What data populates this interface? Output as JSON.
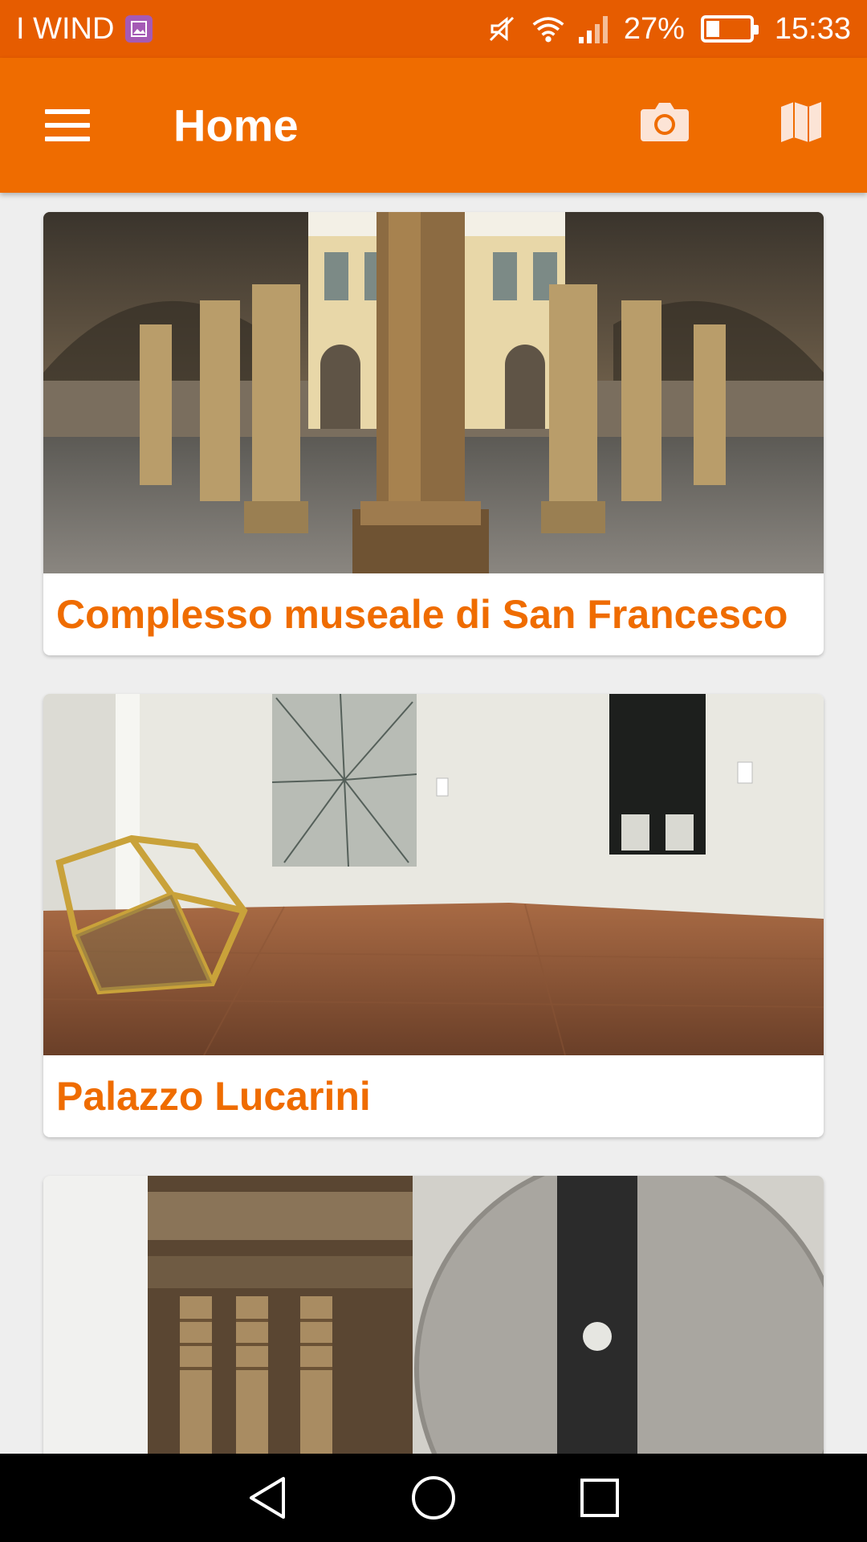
{
  "status_bar": {
    "carrier": "I WIND",
    "battery": "27%",
    "time": "15:33"
  },
  "app_bar": {
    "title": "Home",
    "icons": [
      "menu-icon",
      "camera-icon",
      "map-icon"
    ]
  },
  "cards": [
    {
      "title": "Complesso museale di San Francesco"
    },
    {
      "title": "Palazzo Lucarini"
    },
    {
      "title": ""
    }
  ],
  "colors": {
    "status_bar": "#e65c00",
    "app_bar": "#ef6c00",
    "accent_text": "#ef6c00"
  }
}
